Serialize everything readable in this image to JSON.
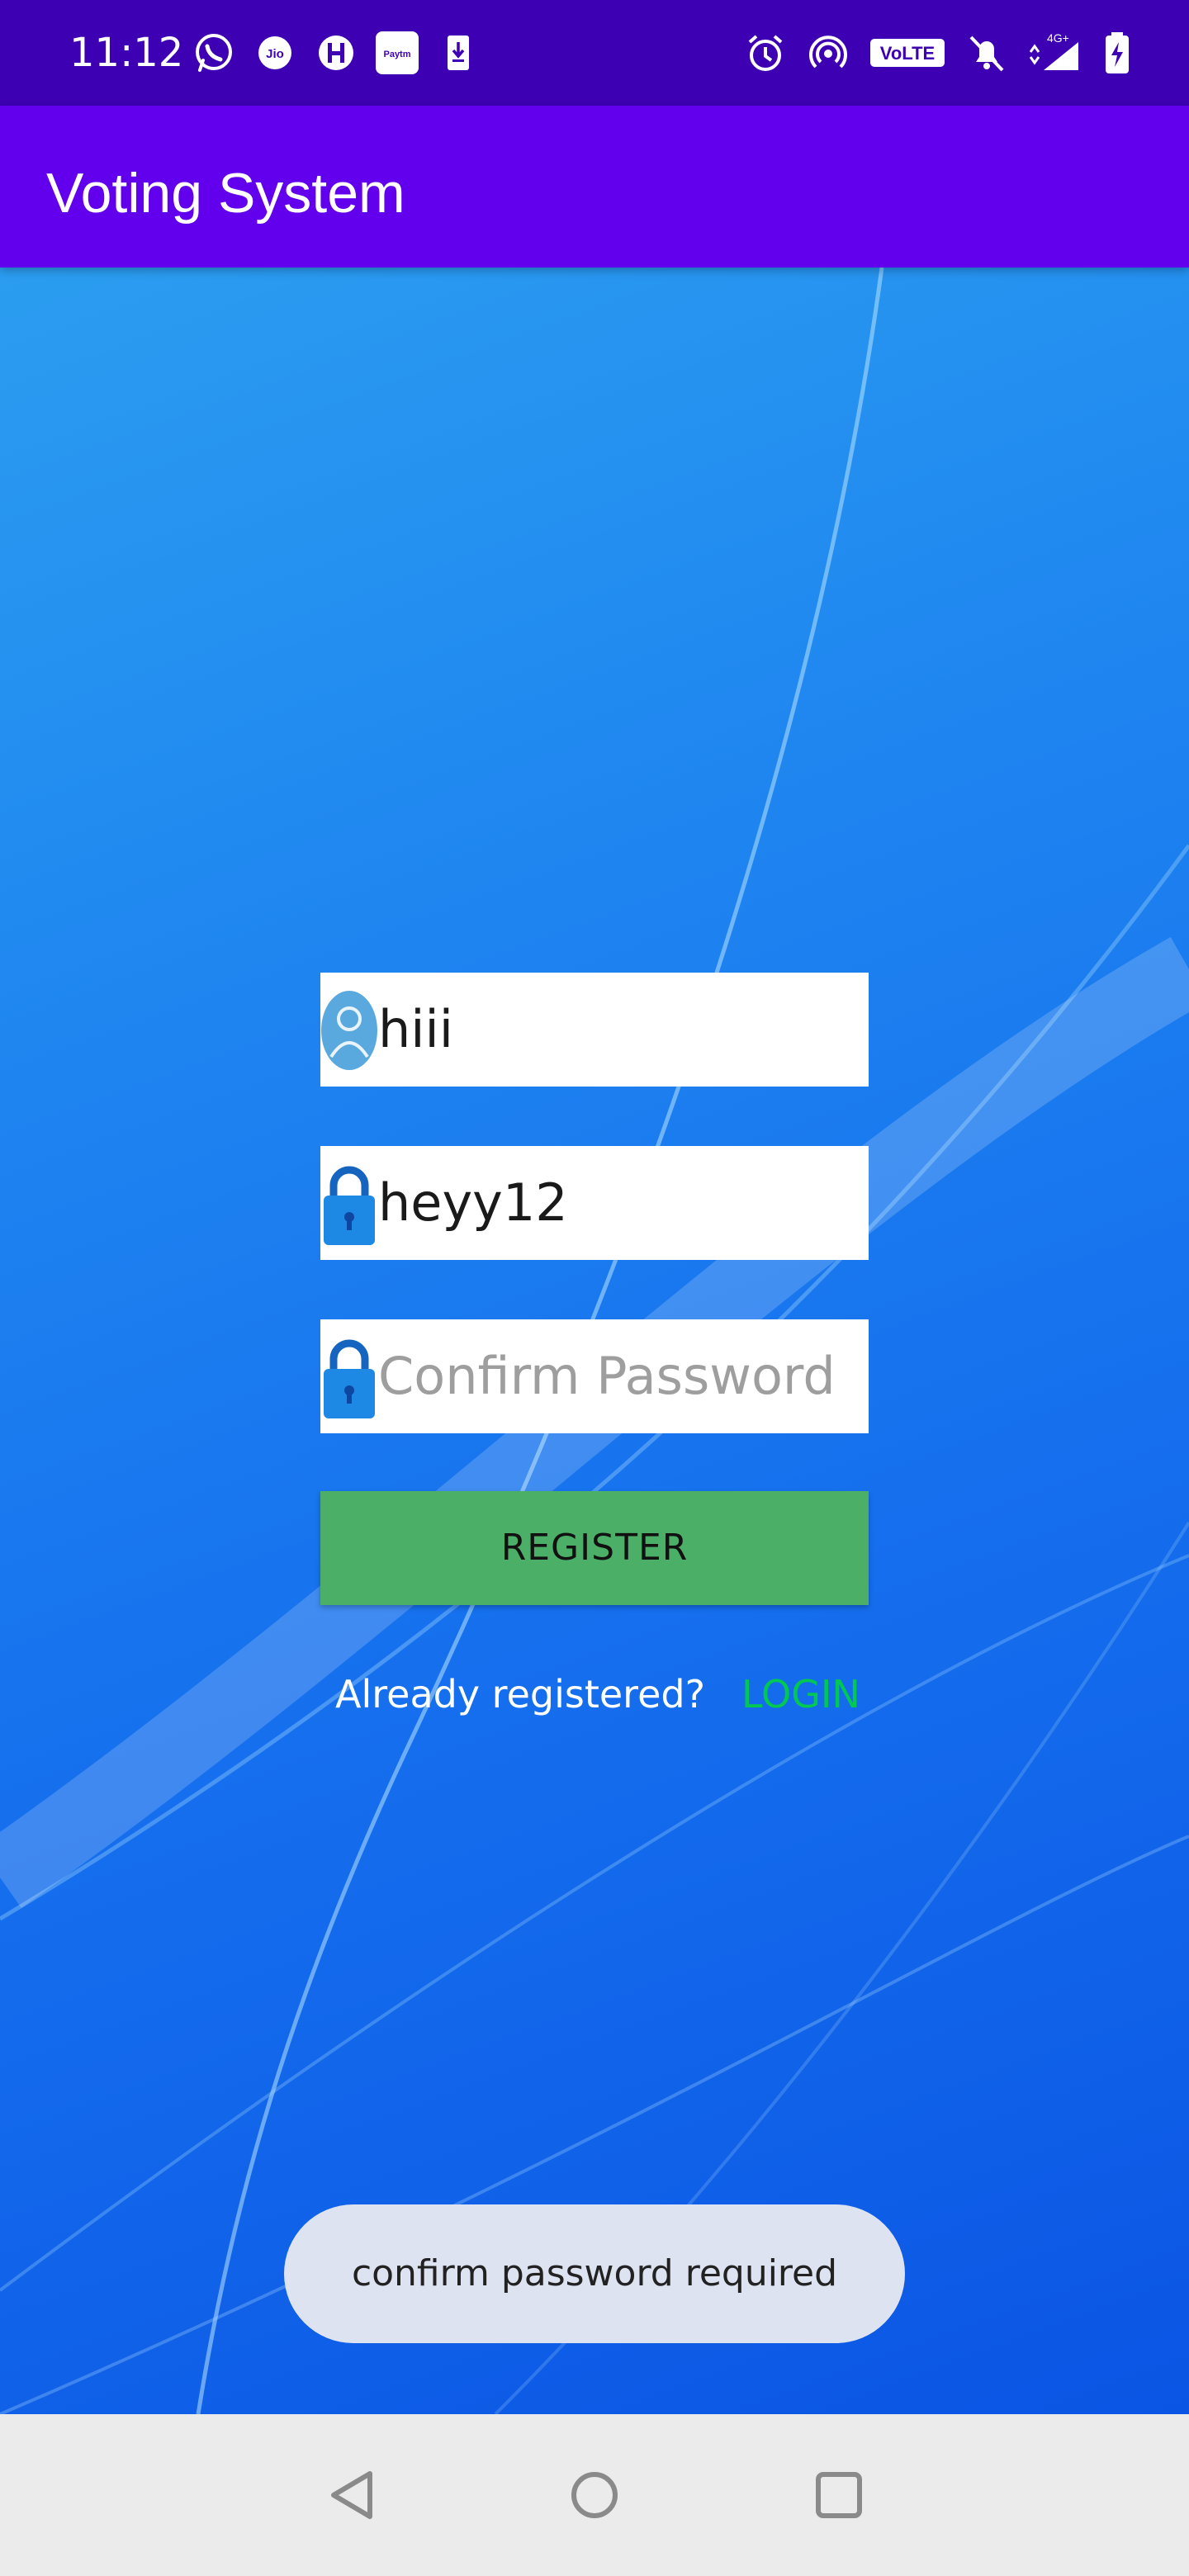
{
  "status_bar": {
    "time": "11:12",
    "left_icons": [
      "whatsapp-icon",
      "jio-icon",
      "hike-icon",
      "paytm-icon",
      "download-icon"
    ],
    "right_icons": [
      "alarm-icon",
      "hotspot-icon",
      "volte-icon",
      "mute-icon",
      "signal-4g-icon",
      "battery-charging-icon"
    ],
    "paytm_label": "Paytm",
    "jio_label": "Jio",
    "volte_label": "VoLTE",
    "network_label": "4G+"
  },
  "app_bar": {
    "title": "Voting System"
  },
  "form": {
    "username": {
      "value": "hiii",
      "icon": "user-icon"
    },
    "password": {
      "value": "heyy12",
      "icon": "lock-icon"
    },
    "confirm_password": {
      "value": "",
      "placeholder": "Confirm Password",
      "icon": "lock-icon"
    },
    "register_label": "REGISTER",
    "already_registered_text": "Already registered?",
    "login_label": "LOGIN"
  },
  "toast": {
    "message": "confirm password required"
  },
  "nav_bar": {
    "icons": [
      "back-icon",
      "home-icon",
      "recents-icon"
    ]
  },
  "colors": {
    "status_bar": "#3d00b3",
    "app_bar": "#6200ee",
    "register_button": "#4caf68",
    "login_link": "#00c853",
    "toast_bg": "#dde3f1"
  }
}
